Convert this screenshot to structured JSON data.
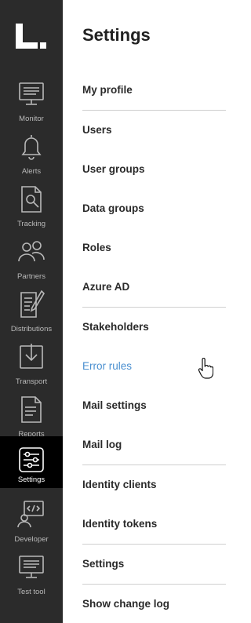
{
  "nav": {
    "items": [
      {
        "label": "Monitor",
        "icon": "monitor-icon"
      },
      {
        "label": "Alerts",
        "icon": "bell-icon"
      },
      {
        "label": "Tracking",
        "icon": "document-search-icon"
      },
      {
        "label": "Partners",
        "icon": "people-icon"
      },
      {
        "label": "Distributions",
        "icon": "document-edit-icon"
      },
      {
        "label": "Transport",
        "icon": "download-icon"
      },
      {
        "label": "Reports",
        "icon": "report-icon"
      },
      {
        "label": "Settings",
        "icon": "sliders-icon",
        "active": true
      },
      {
        "label": "Developer",
        "icon": "code-monitor-icon"
      },
      {
        "label": "Test tool",
        "icon": "test-monitor-icon"
      }
    ]
  },
  "settings": {
    "title": "Settings",
    "items": [
      {
        "label": "My profile"
      },
      {
        "label": "Users"
      },
      {
        "label": "User groups"
      },
      {
        "label": "Data groups"
      },
      {
        "label": "Roles"
      },
      {
        "label": "Azure AD"
      },
      {
        "label": "Stakeholders"
      },
      {
        "label": "Error rules",
        "hovered": true
      },
      {
        "label": "Mail settings"
      },
      {
        "label": "Mail log"
      },
      {
        "label": "Identity clients"
      },
      {
        "label": "Identity tokens"
      },
      {
        "label": "Settings"
      },
      {
        "label": "Show change log"
      }
    ]
  },
  "colors": {
    "rail_bg": "#2b2b2b",
    "rail_active_bg": "#000000",
    "hover_link": "#4a8fd0"
  }
}
